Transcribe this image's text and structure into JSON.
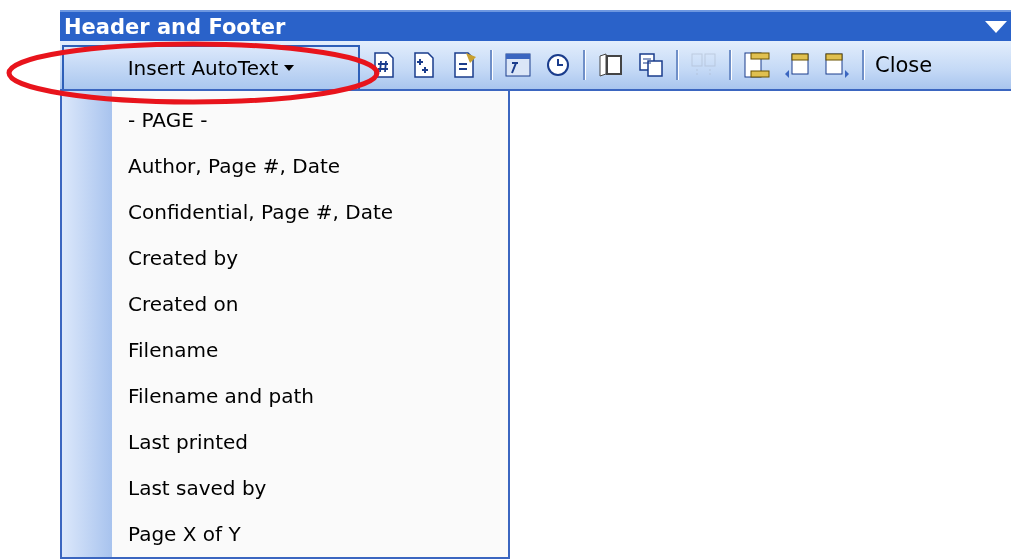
{
  "window": {
    "title": "Header and Footer"
  },
  "toolbar": {
    "autotext_button": {
      "label": "Insert AutoText",
      "pressed": true
    },
    "items": [
      {
        "kind": "icon",
        "disabled": false
      },
      {
        "kind": "icon",
        "disabled": false
      },
      {
        "kind": "icon",
        "disabled": false
      },
      {
        "kind": "separator"
      },
      {
        "kind": "icon",
        "disabled": false
      },
      {
        "kind": "icon",
        "disabled": false
      },
      {
        "kind": "separator"
      },
      {
        "kind": "icon",
        "disabled": false
      },
      {
        "kind": "icon",
        "disabled": false
      },
      {
        "kind": "separator"
      },
      {
        "kind": "icon",
        "disabled": true
      },
      {
        "kind": "separator"
      },
      {
        "kind": "icon",
        "disabled": false
      },
      {
        "kind": "icon",
        "disabled": false
      },
      {
        "kind": "icon",
        "disabled": false
      },
      {
        "kind": "separator"
      },
      {
        "kind": "text",
        "label": "Close"
      }
    ]
  },
  "menu": {
    "items": [
      "- PAGE -",
      "Author, Page #, Date",
      "Confidential, Page #, Date",
      "Created by",
      "Created on",
      "Filename",
      "Filename and path",
      "Last printed",
      "Last saved by",
      "Page X of Y"
    ]
  }
}
